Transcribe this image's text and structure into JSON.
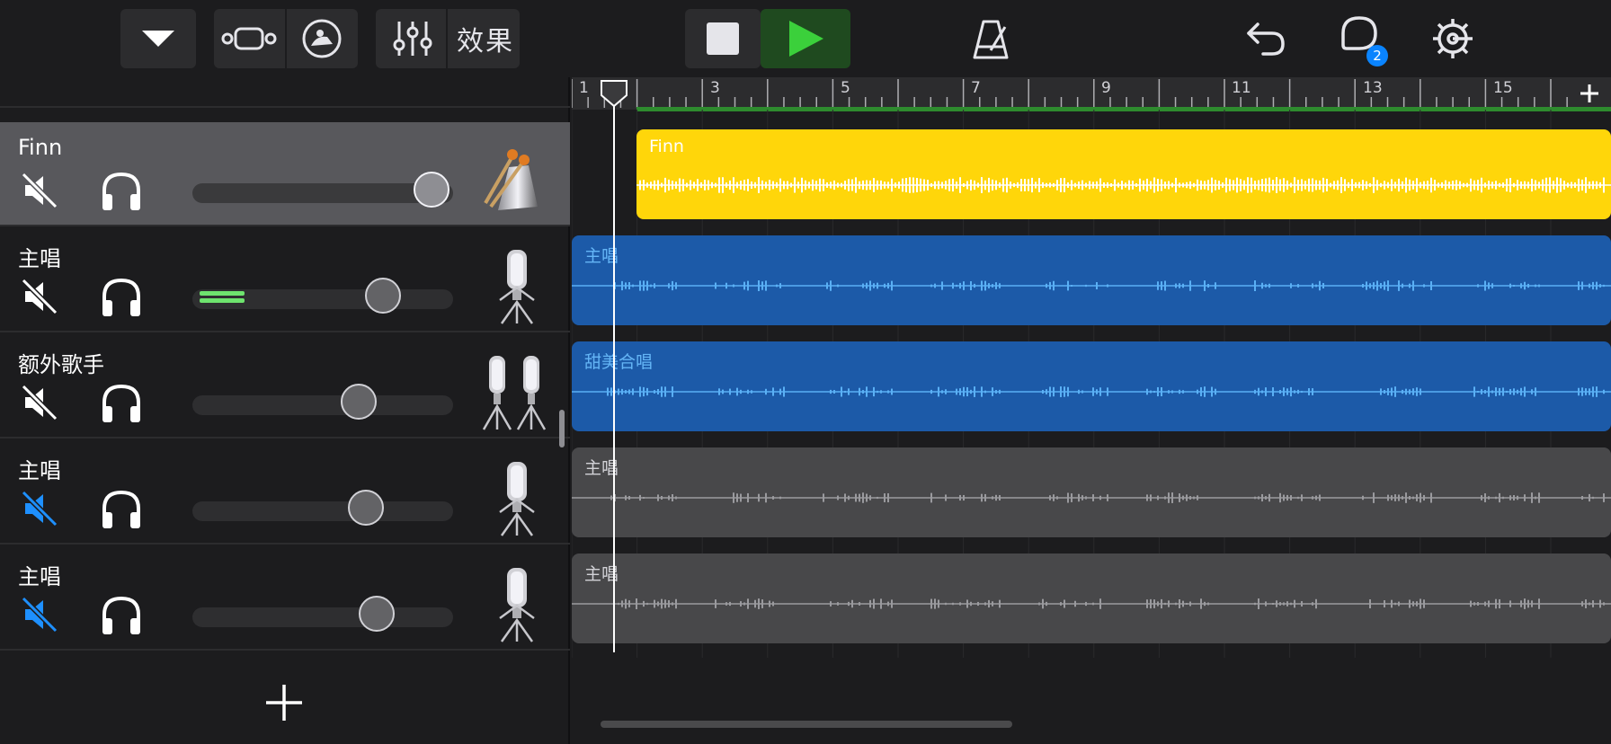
{
  "toolbar": {
    "fx_label": "效果",
    "notification_badge": "2",
    "play_color": "#3bd03b",
    "active_play_bg": "#1f4a1f"
  },
  "ruler": {
    "bar_numbers": [
      "1",
      "3",
      "5",
      "7",
      "9",
      "11",
      "13",
      "15"
    ],
    "cycle_color": "#2e8b2e"
  },
  "tracks": [
    {
      "name": "Finn",
      "muted": false,
      "selected": true,
      "volume": 0.88,
      "instrument": "cowbell-drumsticks-icon"
    },
    {
      "name": "主唱",
      "muted": false,
      "selected": false,
      "volume": 0.74,
      "instrument": "microphone-icon",
      "metering": true
    },
    {
      "name": "额外歌手",
      "muted": false,
      "selected": false,
      "volume": 0.64,
      "instrument": "double-microphone-icon"
    },
    {
      "name": "主唱",
      "muted": true,
      "selected": false,
      "volume": 0.67,
      "instrument": "microphone-icon"
    },
    {
      "name": "主唱",
      "muted": true,
      "selected": false,
      "volume": 0.7,
      "instrument": "microphone-icon"
    }
  ],
  "regions": [
    {
      "name": "Finn",
      "color": "#ffd60a",
      "text_color": "#ffffff",
      "wave_color": "#ffffff"
    },
    {
      "name": "主唱",
      "color": "#1c5aa8",
      "text_color": "#64b5f6",
      "wave_color": "#5ab0f5"
    },
    {
      "name": "甜美合唱",
      "color": "#1c5aa8",
      "text_color": "#64b5f6",
      "wave_color": "#5ab0f5"
    },
    {
      "name": "主唱",
      "color": "#48484a",
      "text_color": "#d1d1d6",
      "wave_color": "#9a9a9e"
    },
    {
      "name": "主唱",
      "color": "#48484a",
      "text_color": "#d1d1d6",
      "wave_color": "#9a9a9e"
    }
  ],
  "colors": {
    "muted_active": "#1e90ff",
    "muted_inactive": "#ffffff",
    "meter": "#6ee36e"
  }
}
